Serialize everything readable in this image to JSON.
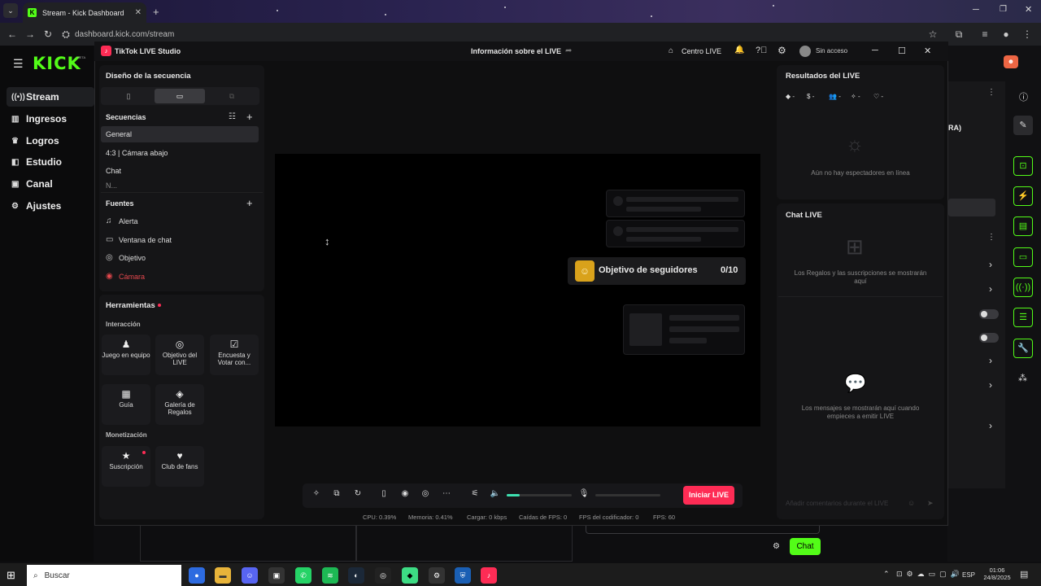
{
  "browser": {
    "tab_title": "Stream - Kick Dashboard",
    "tab_icon": "K",
    "url": "dashboard.kick.com/stream"
  },
  "kick": {
    "logo": "KICK",
    "beta": "BETA",
    "nav": [
      {
        "label": "Stream",
        "icon": "stream-icon",
        "glyph": "((•))"
      },
      {
        "label": "Ingresos",
        "icon": "revenue-icon",
        "glyph": "▥"
      },
      {
        "label": "Logros",
        "icon": "trophy-icon",
        "glyph": "🏆"
      },
      {
        "label": "Estudio",
        "icon": "studio-icon",
        "glyph": "◧"
      },
      {
        "label": "Canal",
        "icon": "channel-icon",
        "glyph": "▣"
      },
      {
        "label": "Ajustes",
        "icon": "settings-icon",
        "glyph": "⚙"
      }
    ],
    "partial_text": "RA)",
    "chat_button": "Chat",
    "accent": "#53fc18"
  },
  "tiktok": {
    "app_title": "TikTok LIVE Studio",
    "center_title": "Información sobre el LIVE",
    "centro_live": "Centro LIVE",
    "account": "Sin acceso",
    "layout_title": "Diseño de la secuencia",
    "sequences_title": "Secuencias",
    "sequences": [
      "General",
      "4:3 | Cámara abajo",
      "Chat",
      "N..."
    ],
    "sources_title": "Fuentes",
    "sources": [
      {
        "label": "Alerta",
        "icon": "bell-icon",
        "glyph": "🔔"
      },
      {
        "label": "Ventana de chat",
        "icon": "chat-window-icon",
        "glyph": "▭"
      },
      {
        "label": "Objetivo",
        "icon": "target-icon",
        "glyph": "◎"
      },
      {
        "label": "Cámara",
        "icon": "camera-icon",
        "glyph": "◉"
      }
    ],
    "tools_title": "Herramientas",
    "interaction_title": "Interacción",
    "tools": [
      {
        "label": "Juego en equipo",
        "glyph": "♟"
      },
      {
        "label": "Objetivo del LIVE",
        "glyph": "◎"
      },
      {
        "label": "Encuesta y Votar con...",
        "glyph": "☑"
      },
      {
        "label": "Guía",
        "glyph": "▦"
      },
      {
        "label": "Galería de Regalos",
        "glyph": "◈"
      }
    ],
    "monetization_title": "Monetización",
    "monetization": [
      {
        "label": "Suscripción",
        "glyph": "★"
      },
      {
        "label": "Club de fans",
        "glyph": "♥"
      }
    ],
    "goal_label": "Objetivo de seguidores",
    "goal_value": "0/10",
    "results_title": "Resultados del LIVE",
    "result_stats": [
      "-",
      "-",
      "-",
      "-",
      "-"
    ],
    "no_viewers": "Aún no hay espectadores en línea",
    "chat_title": "Chat LIVE",
    "gifts_msg": "Los Regalos y las suscripciones se mostrarán aquí",
    "messages_msg": "Los mensajes se mostrarán aquí cuando empieces a emitir LIVE",
    "comment_placeholder": "Añadir comentarios durante el LIVE",
    "start_button": "Iniciar LIVE",
    "start_color": "#fe2c55",
    "volume_level": 0.2,
    "stats": [
      "CPU: 0.39%",
      "Memoria: 0.41%",
      "Cargar: 0 kbps",
      "Caídas de FPS: 0",
      "FPS del codificador: 0",
      "FPS: 60"
    ]
  },
  "taskbar": {
    "search": "Buscar",
    "lang": "ESP",
    "time": "01:06",
    "date": "24/8/2025"
  }
}
